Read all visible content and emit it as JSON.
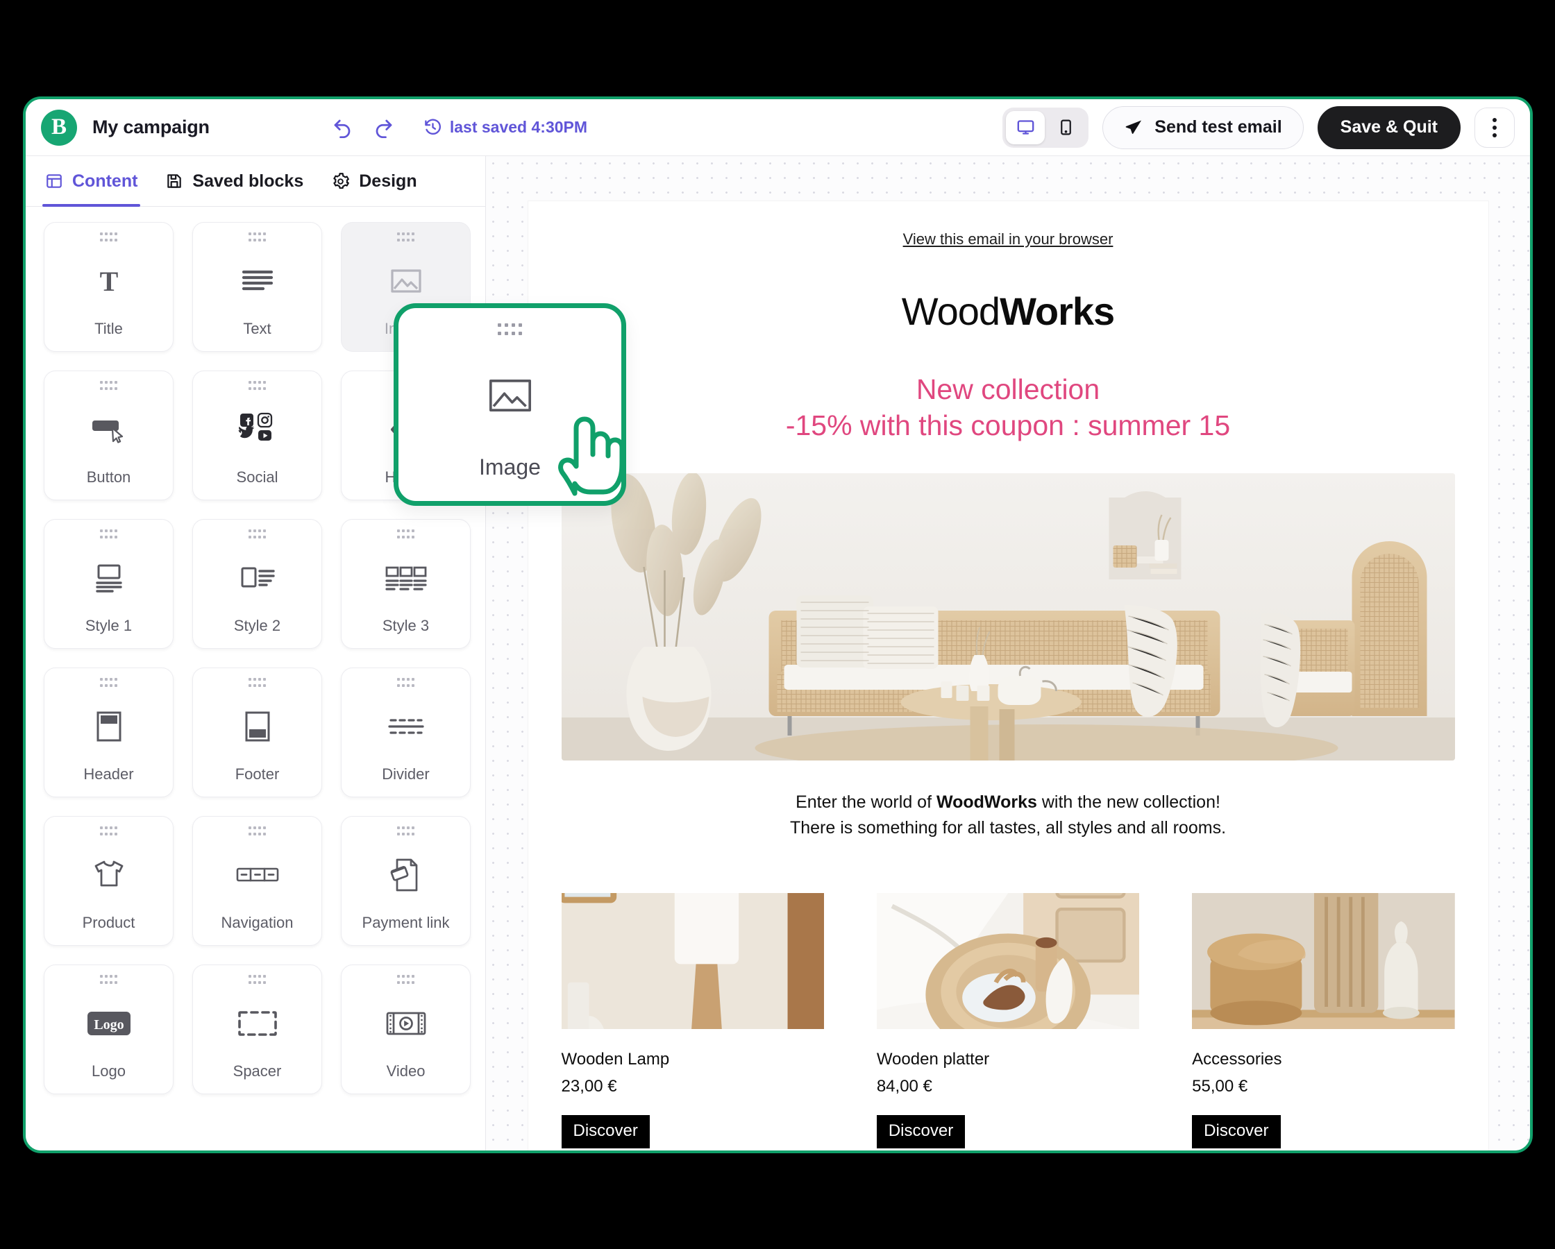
{
  "app": {
    "logo_letter": "B",
    "campaign_title": "My campaign",
    "undo_icon": "undo-arrow-icon",
    "redo_icon": "redo-arrow-icon",
    "saved_status": "last saved 4:30PM",
    "saved_icon": "history-clock-icon",
    "accent_purple": "#6055d8",
    "accent_green": "#10a06a"
  },
  "device_toggle": {
    "desktop_label": "desktop-view",
    "mobile_label": "mobile-view",
    "active": "desktop"
  },
  "actions": {
    "send_test_label": "Send test email",
    "send_test_icon": "paper-plane-icon",
    "save_quit_label": "Save & Quit",
    "more_label": "more-options"
  },
  "tabs": [
    {
      "label": "Content",
      "icon": "layout-panel-icon",
      "active": true
    },
    {
      "label": "Saved blocks",
      "icon": "floppy-disk-icon",
      "active": false
    },
    {
      "label": "Design",
      "icon": "gear-icon",
      "active": false
    }
  ],
  "blocks": [
    {
      "label": "Title",
      "icon": "title-t-icon",
      "state": "normal"
    },
    {
      "label": "Text",
      "icon": "text-lines-icon",
      "state": "normal"
    },
    {
      "label": "Image",
      "icon": "image-icon",
      "state": "ghost"
    },
    {
      "label": "Button",
      "icon": "button-cursor-icon",
      "state": "normal"
    },
    {
      "label": "Social",
      "icon": "social-networks-icon",
      "state": "normal"
    },
    {
      "label": "HTML",
      "icon": "code-chevrons-icon",
      "state": "normal"
    },
    {
      "label": "Style 1",
      "icon": "style-1-icon",
      "state": "normal"
    },
    {
      "label": "Style 2",
      "icon": "style-2-icon",
      "state": "normal"
    },
    {
      "label": "Style 3",
      "icon": "style-3-icon",
      "state": "normal"
    },
    {
      "label": "Header",
      "icon": "header-icon",
      "state": "normal"
    },
    {
      "label": "Footer",
      "icon": "footer-icon",
      "state": "normal"
    },
    {
      "label": "Divider",
      "icon": "divider-icon",
      "state": "normal"
    },
    {
      "label": "Product",
      "icon": "tshirt-icon",
      "state": "normal"
    },
    {
      "label": "Navigation",
      "icon": "navigation-bar-icon",
      "state": "normal"
    },
    {
      "label": "Payment link",
      "icon": "payment-card-doc-icon",
      "state": "normal"
    },
    {
      "label": "Logo",
      "icon": "logo-badge-icon",
      "state": "normal",
      "badge_text": "Logo"
    },
    {
      "label": "Spacer",
      "icon": "spacer-dashed-icon",
      "state": "normal"
    },
    {
      "label": "Video",
      "icon": "video-film-icon",
      "state": "normal"
    }
  ],
  "drag_overlay": {
    "label": "Image",
    "icon": "image-icon",
    "cursor_icon": "pointing-hand-icon"
  },
  "email": {
    "view_in_browser": "View this email in your browser",
    "logo_light": "Wood",
    "logo_bold": "Works",
    "promo_line_1": "New collection",
    "promo_line_2": "-15% with this coupon : summer 15",
    "promo_color": "#e0477f",
    "hero_alt": "boho living room with rattan sofa and pampas grass",
    "intro_prefix": "Enter the world of ",
    "intro_brand": "WoodWorks",
    "intro_suffix": " with the new collection!",
    "intro_line_2": "There is something for all tastes, all styles and all rooms.",
    "products": [
      {
        "name": "Wooden Lamp",
        "price": "23,00 €",
        "cta": "Discover",
        "alt": "wooden table lamp on console"
      },
      {
        "name": "Wooden platter",
        "price": "84,00 €",
        "cta": "Discover",
        "alt": "wooden tray with plate on bed"
      },
      {
        "name": "Accessories",
        "price": "55,00 €",
        "cta": "Discover",
        "alt": "wooden jars and vase on shelf"
      }
    ]
  }
}
